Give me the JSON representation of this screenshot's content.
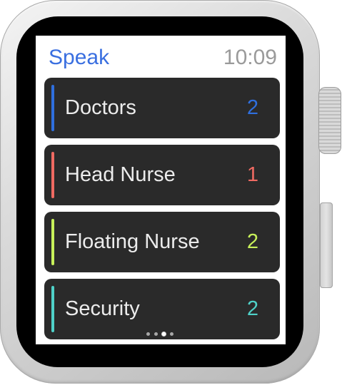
{
  "app": {
    "title": "Speak",
    "time": "10:09"
  },
  "list": [
    {
      "label": "Doctors",
      "count": "2",
      "color": "#2f6fde"
    },
    {
      "label": "Head Nurse",
      "count": "1",
      "color": "#ef6a62"
    },
    {
      "label": "Floating Nurse",
      "count": "2",
      "color": "#c7f05a"
    },
    {
      "label": "Security",
      "count": "2",
      "color": "#4fd1c8"
    }
  ],
  "pagination": {
    "count": 4,
    "active_index": 2
  }
}
